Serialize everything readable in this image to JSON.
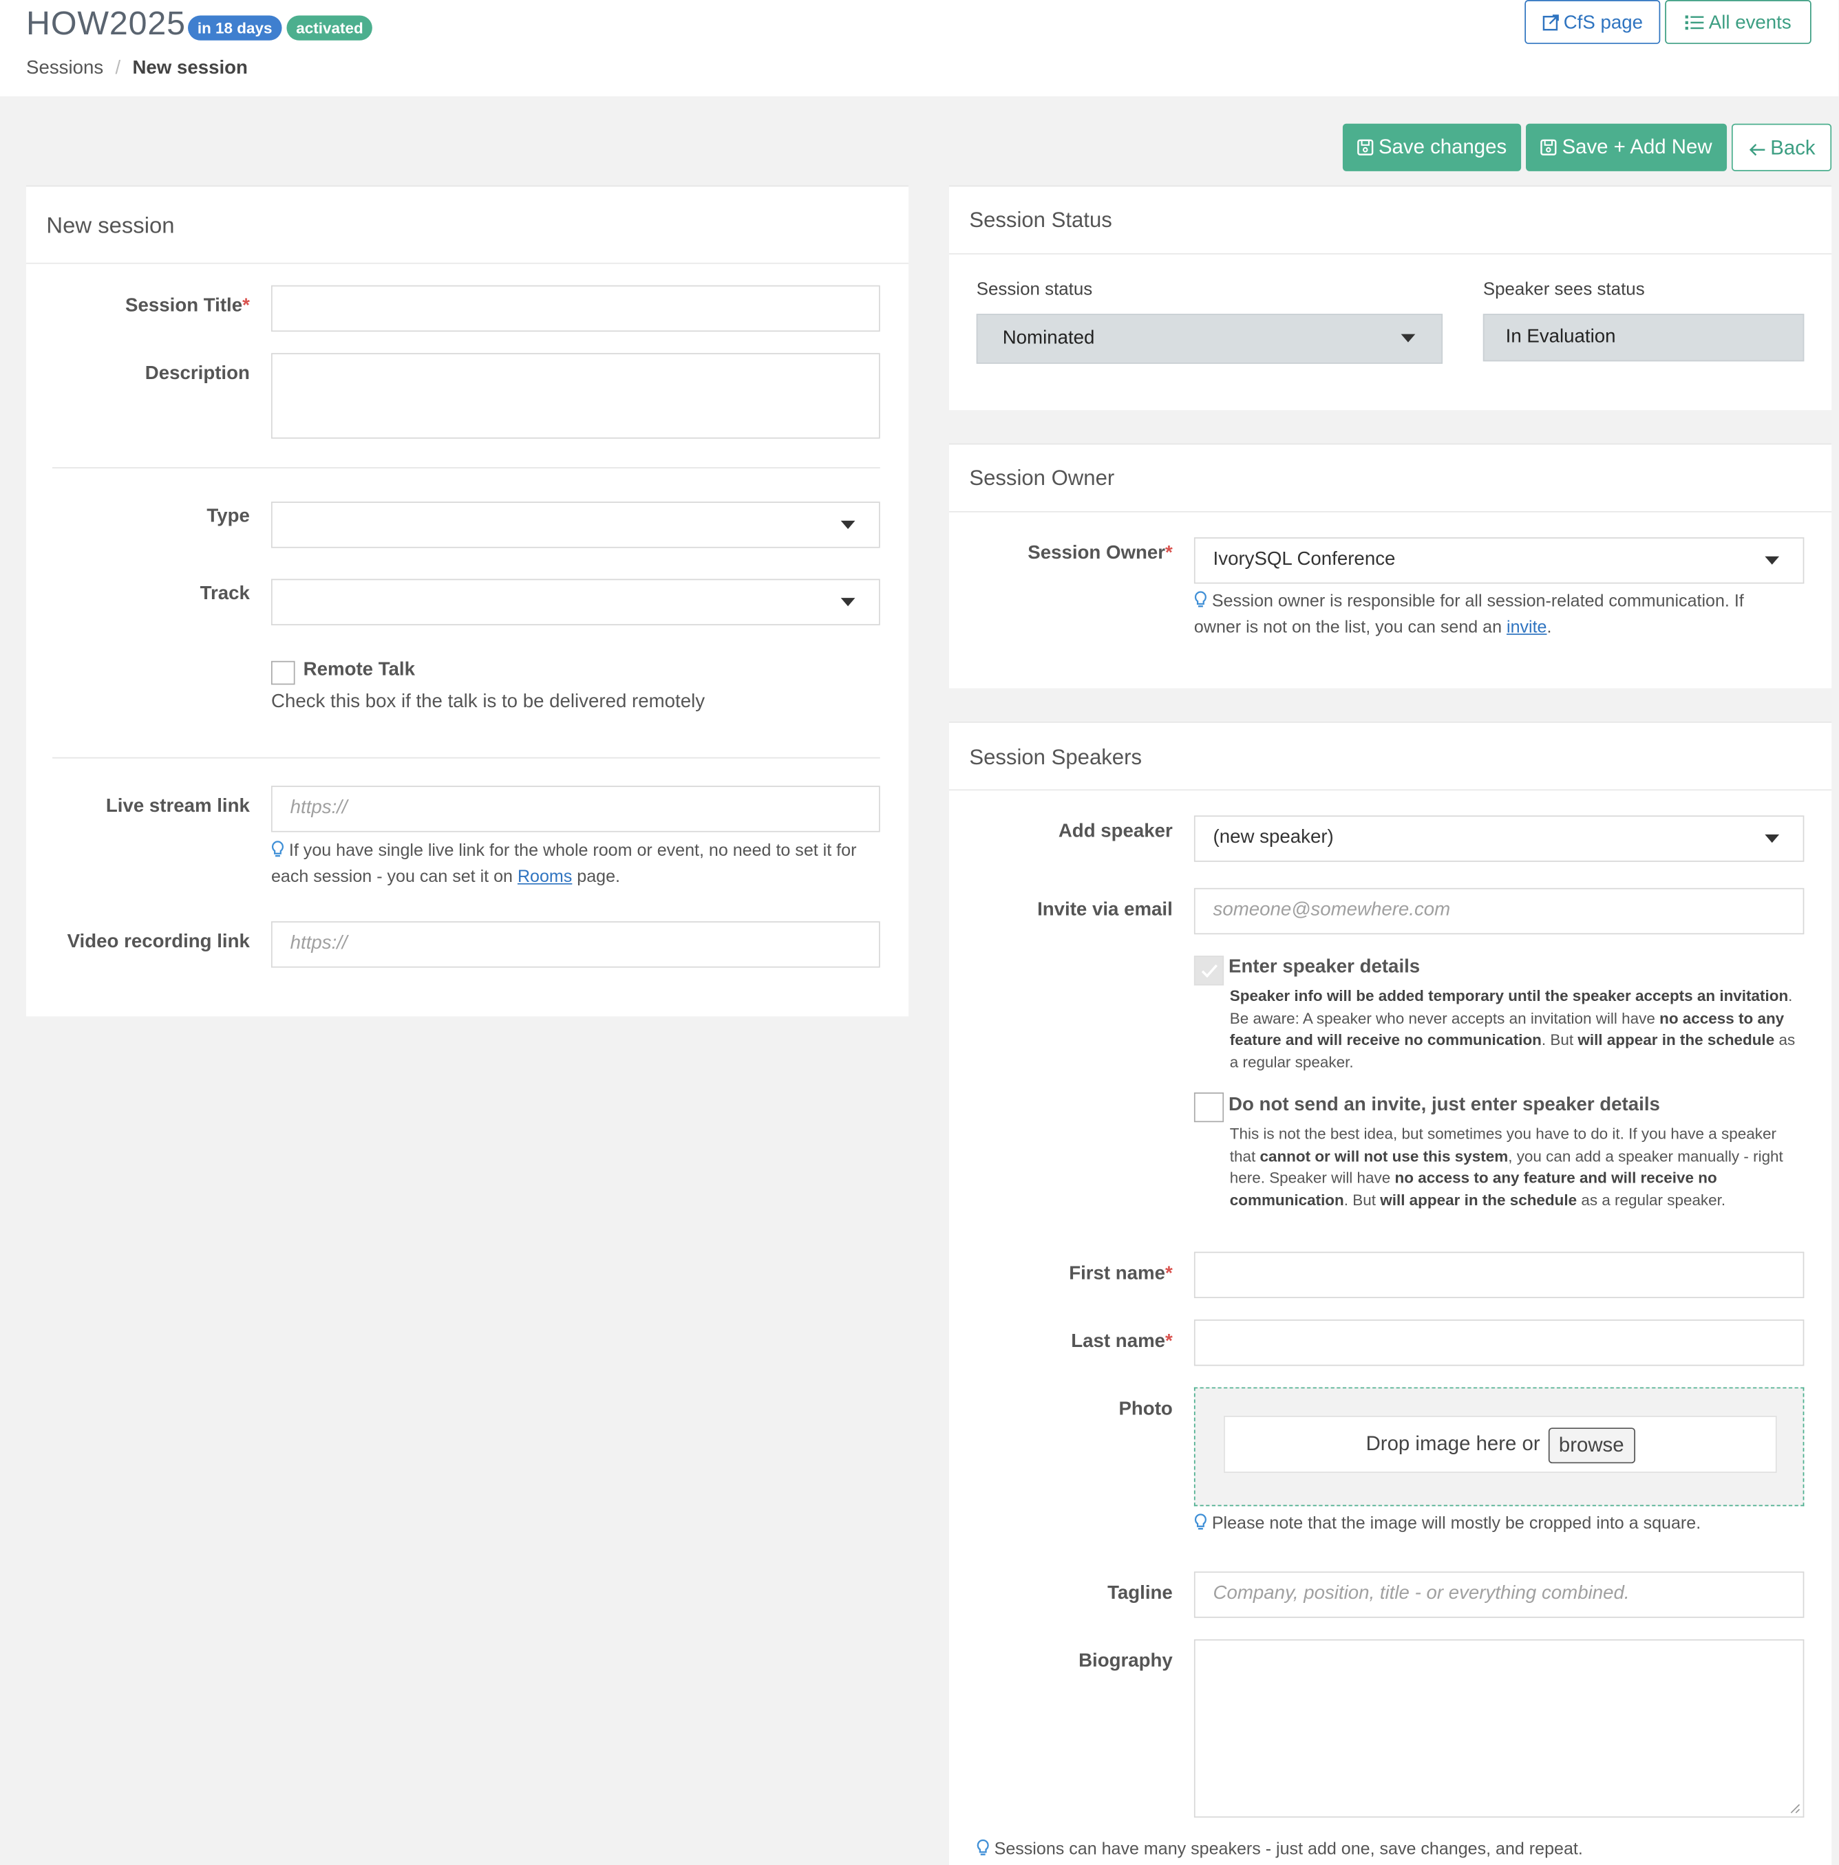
{
  "header": {
    "event_title": "HOW2025",
    "badge_days": "in 18 days",
    "badge_status": "activated",
    "breadcrumb_root": "Sessions",
    "breadcrumb_sep": "/",
    "breadcrumb_current": "New session",
    "cfs_button": "CfS page",
    "all_events_button": "All events"
  },
  "actions": {
    "save": "Save changes",
    "save_add": "Save + Add New",
    "back": "Back"
  },
  "left_panel": {
    "title": "New session",
    "session_title_label": "Session Title",
    "required_mark": "*",
    "description_label": "Description",
    "type_label": "Type",
    "track_label": "Track",
    "remote_talk_label": "Remote Talk",
    "remote_talk_hint": "Check this box if the talk is to be delivered remotely",
    "live_stream_label": "Live stream link",
    "live_stream_placeholder": "https://",
    "live_stream_hint_before": "If you have single live link for the whole room or event, no need to set it for each session - you can set it on ",
    "live_stream_hint_link": "Rooms",
    "live_stream_hint_after": " page.",
    "video_label": "Video recording link",
    "video_placeholder": "https://"
  },
  "status_panel": {
    "title": "Session Status",
    "status_label": "Session status",
    "status_value": "Nominated",
    "speaker_sees_label": "Speaker sees status",
    "speaker_sees_value": "In Evaluation"
  },
  "owner_panel": {
    "title": "Session Owner",
    "owner_label": "Session Owner",
    "owner_value": "IvorySQL Conference",
    "hint_before": "Session owner is responsible for all session-related communication. If owner is not on the list, you can send an ",
    "hint_link": "invite",
    "hint_after": "."
  },
  "speakers_panel": {
    "title": "Session Speakers",
    "add_speaker_label": "Add speaker",
    "add_speaker_value": "(new speaker)",
    "invite_label": "Invite via email",
    "invite_placeholder": "someone@somewhere.com",
    "enter_details_label": "Enter speaker details",
    "enter_details_t1": "Speaker info will be added temporary until the speaker accepts an invitation",
    "enter_details_t2": ". Be aware: A speaker who never accepts an invitation will have ",
    "enter_details_t3": "no access to any feature and will receive no communication",
    "enter_details_t4": ". But ",
    "enter_details_t5": "will appear in the schedule",
    "enter_details_t6": " as a regular speaker.",
    "no_invite_label": "Do not send an invite, just enter speaker details",
    "no_invite_t1": "This is not the best idea, but sometimes you have to do it. If you have a speaker that ",
    "no_invite_t2": "cannot or will not use this system",
    "no_invite_t3": ", you can add a speaker manually - right here. Speaker will have ",
    "no_invite_t4": "no access to any feature and will receive no communication",
    "no_invite_t5": ". But ",
    "no_invite_t6": "will appear in the schedule",
    "no_invite_t7": " as a regular speaker.",
    "first_name_label": "First name",
    "last_name_label": "Last name",
    "photo_label": "Photo",
    "drop_text": "Drop image here or",
    "browse_button": "browse",
    "photo_hint": "Please note that the image will mostly be cropped into a square.",
    "tagline_label": "Tagline",
    "tagline_placeholder": "Company, position, title - or everything combined.",
    "biography_label": "Biography",
    "footer_hint": "Sessions can have many speakers - just add one, save changes, and repeat."
  },
  "colors": {
    "accent_green": "#4caf8e",
    "accent_blue": "#2f74c0",
    "required_red": "#d9534f"
  },
  "icons": [
    "external-link-icon",
    "list-icon",
    "save-icon",
    "arrow-left-icon",
    "lightbulb-icon",
    "chevron-down-icon",
    "checkmark-icon"
  ]
}
